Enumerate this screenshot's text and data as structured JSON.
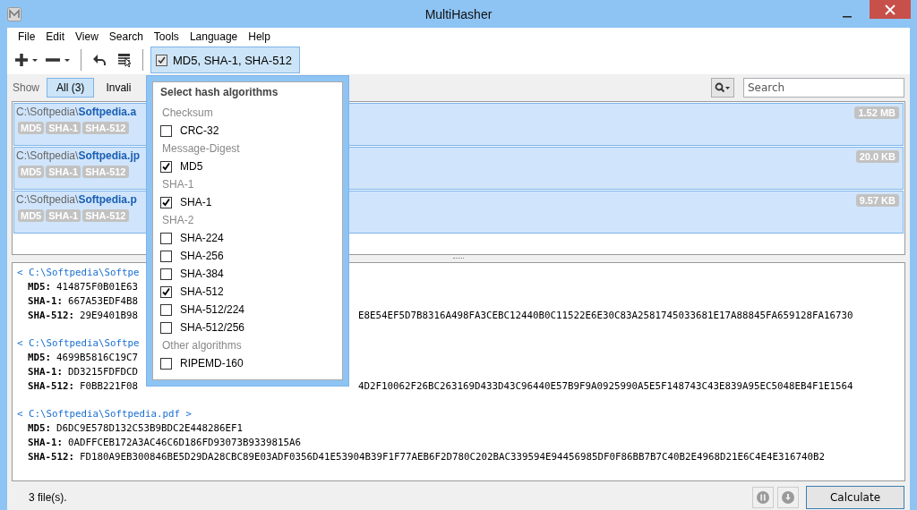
{
  "window": {
    "title": "MultiHasher"
  },
  "menu": [
    "File",
    "Edit",
    "View",
    "Search",
    "Tools",
    "Language",
    "Help"
  ],
  "toolbar": {
    "hash_selector": {
      "label": "MD5, SHA-1, SHA-512",
      "checked": true
    }
  },
  "filter": {
    "label": "Show",
    "tabs": [
      {
        "label": "All (3)",
        "selected": true
      },
      {
        "label": "Invali",
        "selected": false
      }
    ]
  },
  "search": {
    "placeholder": "Search"
  },
  "files": [
    {
      "dir": "C:\\Softpedia\\",
      "name": "Softpedia.a",
      "size": "1.52 MB",
      "tags": [
        "MD5",
        "SHA-1",
        "SHA-512"
      ]
    },
    {
      "dir": "C:\\Softpedia\\",
      "name": "Softpedia.jp",
      "size": "20.0 KB",
      "tags": [
        "MD5",
        "SHA-1",
        "SHA-512"
      ]
    },
    {
      "dir": "C:\\Softpedia\\",
      "name": "Softpedia.p",
      "size": "9.57 KB",
      "tags": [
        "MD5",
        "SHA-1",
        "SHA-512"
      ]
    }
  ],
  "results": [
    {
      "header": "< C:\\Softpedia\\Softpe",
      "lines": [
        {
          "label": "MD5:",
          "value": "414875F0B01E63"
        },
        {
          "label": "SHA-1:",
          "value": "667A53EDF4B8"
        },
        {
          "label": "SHA-512:",
          "value": "29E9401B98",
          "value_right": "E8E54EF5D7B8316A498FA3CEBC12440B0C11522E6E30C83A2581745033681E17A88845FA659128FA16730"
        }
      ]
    },
    {
      "header": "< C:\\Softpedia\\Softpe",
      "lines": [
        {
          "label": "MD5:",
          "value": "4699B5816C19C7"
        },
        {
          "label": "SHA-1:",
          "value": "DD3215FDFDCD"
        },
        {
          "label": "SHA-512:",
          "value": "F0BB221F08",
          "value_right": "4D2F10062F26BC263169D433D43C96440E57B9F9A0925990A5E5F148743C43E839A95EC5048EB4F1E1564"
        }
      ]
    },
    {
      "header": "< C:\\Softpedia\\Softpedia.pdf >",
      "lines": [
        {
          "label": "MD5:",
          "value": "D6DC9E578D132C53B9BDC2E448286EF1"
        },
        {
          "label": "SHA-1:",
          "value": "0ADFFCEB172A3AC46C6D186FD93073B9339815A6"
        },
        {
          "label": "SHA-512:",
          "value": "FD180A9EB300846BE5D29DA28CBC89E03ADF0356D41E53904B39F1F77AEB6F2D780C202BAC339594E94456985DF0F86BB7B7C40B2E4968D21E6C4E4E316740B2"
        }
      ]
    }
  ],
  "dropdown": {
    "title": "Select hash algorithms",
    "items": [
      {
        "kind": "group",
        "label": "Checksum"
      },
      {
        "kind": "option",
        "label": "CRC-32",
        "checked": false
      },
      {
        "kind": "group",
        "label": "Message-Digest"
      },
      {
        "kind": "option",
        "label": "MD5",
        "checked": true
      },
      {
        "kind": "group",
        "label": "SHA-1"
      },
      {
        "kind": "option",
        "label": "SHA-1",
        "checked": true
      },
      {
        "kind": "group",
        "label": "SHA-2"
      },
      {
        "kind": "option",
        "label": "SHA-224",
        "checked": false
      },
      {
        "kind": "option",
        "label": "SHA-256",
        "checked": false
      },
      {
        "kind": "option",
        "label": "SHA-384",
        "checked": false
      },
      {
        "kind": "option",
        "label": "SHA-512",
        "checked": true
      },
      {
        "kind": "option",
        "label": "SHA-512/224",
        "checked": false
      },
      {
        "kind": "option",
        "label": "SHA-512/256",
        "checked": false
      },
      {
        "kind": "group",
        "label": "Other algorithms"
      },
      {
        "kind": "option",
        "label": "RIPEMD-160",
        "checked": false
      }
    ]
  },
  "status_bar": {
    "text": "3 file(s).",
    "button": "Calculate"
  }
}
